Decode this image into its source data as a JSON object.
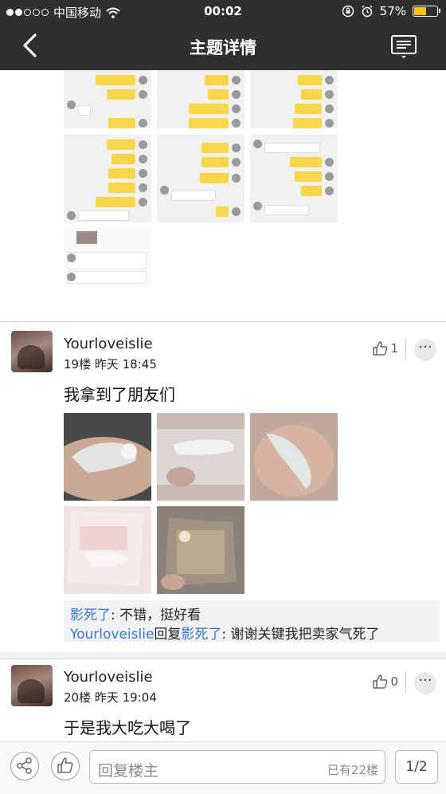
{
  "status_bar": {
    "carrier": "中国移动",
    "time": "00:02",
    "battery": "57%",
    "battery_level": 0.57,
    "signal_bars_filled": 2,
    "signal_bars_total": 5
  },
  "nav": {
    "title": "主题详情",
    "back_icon": "back-arrow-icon",
    "menu_icon": "list-menu-icon"
  },
  "posts": [
    {
      "username": "Yourloveislie",
      "floor": "19楼",
      "time": "昨天 18:45",
      "likes": "1",
      "text": "我拿到了朋友们",
      "photo_count": 5
    },
    {
      "username": "Yourloveislie",
      "floor": "20楼",
      "time": "昨天 19:04",
      "likes": "0",
      "text": "于是我大吃大喝了"
    }
  ],
  "replies": [
    {
      "name": "影死了",
      "text": ": 不错，挺好看"
    },
    {
      "name": "Yourloveislie",
      "mid": "回复",
      "target": "影死了",
      "text": ": 谢谢关键我把卖家气死了"
    }
  ],
  "bottom_bar": {
    "reply_placeholder": "回复楼主",
    "reply_count": "已有22楼",
    "page": "1/2"
  },
  "colors": {
    "topbar": "#2f2f2f",
    "link": "#3a74c9",
    "chat_bubble": "#f8d64a"
  }
}
